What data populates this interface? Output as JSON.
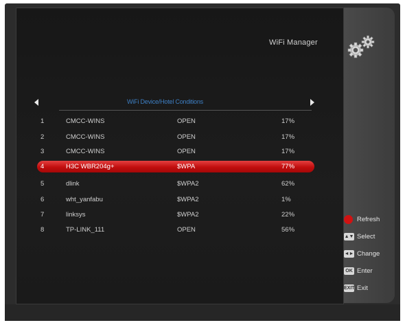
{
  "window": {
    "title": "WiFi Manager",
    "icon": "gear-icon"
  },
  "list_header": {
    "label": "WiFi Device/Hotel Conditions"
  },
  "networks": [
    {
      "num": "1",
      "ssid": "CMCC-WINS",
      "security": "OPEN",
      "signal": "17%"
    },
    {
      "num": "2",
      "ssid": "CMCC-WINS",
      "security": "OPEN",
      "signal": "17%"
    },
    {
      "num": "3",
      "ssid": "CMCC-WINS",
      "security": "OPEN",
      "signal": "17%"
    },
    {
      "num": "4",
      "ssid": "H3C WBR204g+",
      "security": "$WPA",
      "signal": "77%"
    },
    {
      "num": "5",
      "ssid": "dlink",
      "security": "$WPA2",
      "signal": "62%"
    },
    {
      "num": "6",
      "ssid": "wht_yanfabu",
      "security": "$WPA2",
      "signal": "1%"
    },
    {
      "num": "7",
      "ssid": "linksys",
      "security": "$WPA2",
      "signal": "22%"
    },
    {
      "num": "8",
      "ssid": "TP-LINK_111",
      "security": "OPEN",
      "signal": "56%"
    }
  ],
  "selected_index": 3,
  "legend": [
    {
      "key": "",
      "label": "Refresh",
      "style": "red"
    },
    {
      "key": "▲▼",
      "label": "Select",
      "style": "grey"
    },
    {
      "key": "◄►",
      "label": "Change",
      "style": "grey"
    },
    {
      "key": "OK",
      "label": "Enter",
      "style": "grey"
    },
    {
      "key": "EXIT",
      "label": "Exit",
      "style": "grey"
    }
  ],
  "colors": {
    "selection": "#c10e0e",
    "header_text": "#3d7fc4",
    "refresh_key": "#d01212"
  }
}
